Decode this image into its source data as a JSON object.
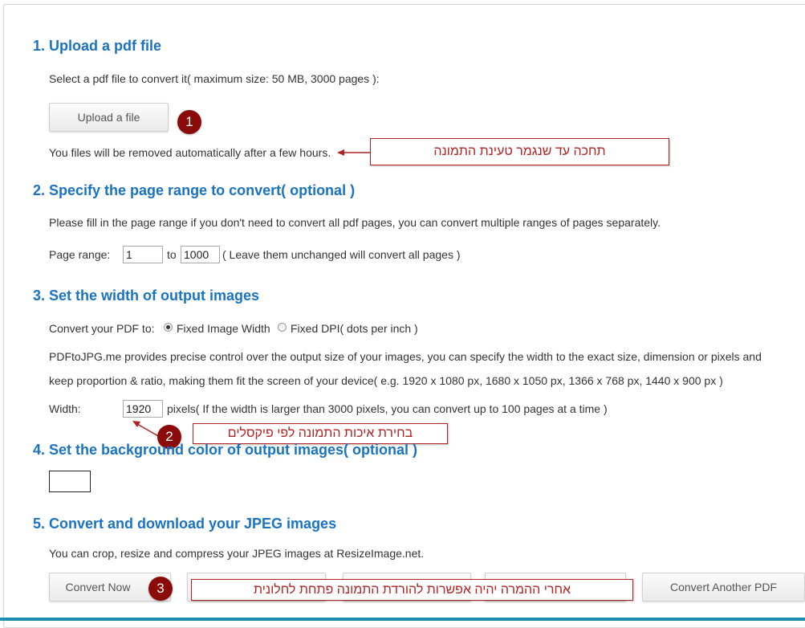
{
  "colors": {
    "heading": "#1a73c2",
    "annotation": "#b22222",
    "badge": "#8b0b0b",
    "text": "#333333"
  },
  "step1": {
    "title": "1. Upload a pdf file",
    "instruction": "Select a pdf file to convert it( maximum size: 50 MB, 3000 pages ):",
    "upload_button": "Upload a file",
    "removal_note": "You files will be removed automatically after a few hours."
  },
  "step2": {
    "title": "2. Specify the page range to convert( optional )",
    "instruction": "Please fill in the page range if you don't need to convert all pdf pages, you can convert multiple ranges of pages separately.",
    "range_label": "Page range:",
    "from_value": "1",
    "to_label": "to",
    "to_value": "1000",
    "range_hint": "( Leave them unchanged will convert all pages )"
  },
  "step3": {
    "title": "3. Set the width of output images",
    "convert_label": "Convert your PDF to:",
    "option_fixed_width": "Fixed Image Width",
    "option_fixed_dpi": "Fixed DPI( dots per inch )",
    "description_line1": "PDFtoJPG.me provides precise control over the output size of your images, you can specify the width to the exact size, dimension or pixels and",
    "description_line2": "keep proportion & ratio, making them fit the screen of your device( e.g. 1920 x 1080 px, 1680 x 1050 px, 1366 x 768 px, 1440 x 900 px )",
    "width_label": "Width:",
    "width_value": "1920",
    "width_hint": "pixels( If the width is larger than 3000 pixels, you can convert up to 100 pages at a time )"
  },
  "step4": {
    "title": "4. Set the background color of output images( optional )"
  },
  "step5": {
    "title": "5. Convert and download your JPEG images",
    "note": "You can crop, resize and compress your JPEG images at ResizeImage.net.",
    "convert_button": "Convert Now",
    "convert_another_button": "Convert Another PDF"
  },
  "annotations": {
    "badge1": "1",
    "badge2": "2",
    "badge3": "3",
    "callout1": "תחכה עד שנגמר טעינת התמונה",
    "callout2": "בחירת איכות התמונה לפי פיקסלים",
    "callout3": "אחרי ההמרה יהיה אפשרות להורדת התמונה פתחת לחלונית"
  }
}
